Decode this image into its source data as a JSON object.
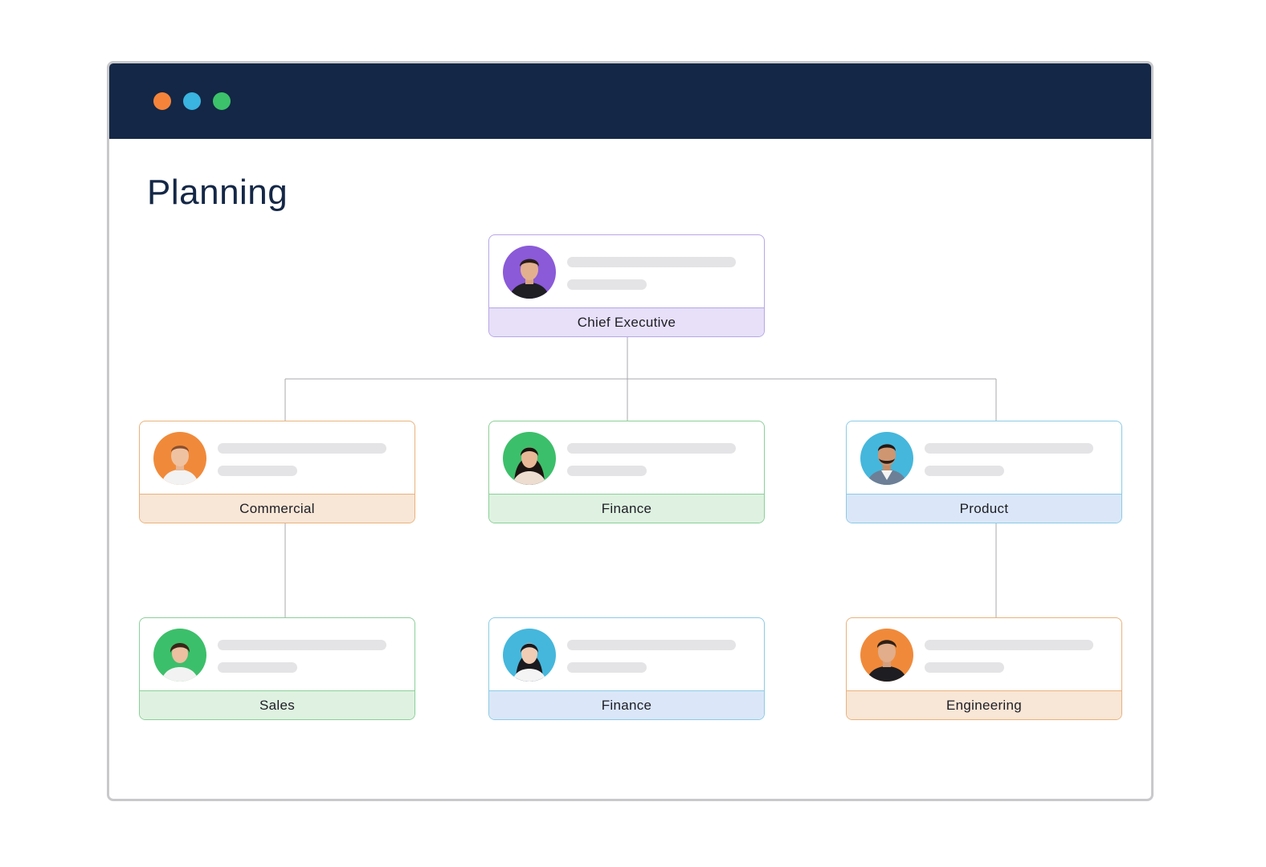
{
  "window": {
    "traffic_lights": [
      {
        "name": "close",
        "color": "#f5843a"
      },
      {
        "name": "minimize",
        "color": "#3ab4e0"
      },
      {
        "name": "maximize",
        "color": "#3cc26a"
      }
    ]
  },
  "page": {
    "title": "Planning"
  },
  "org_chart": {
    "root": {
      "label": "Chief Executive",
      "accent": "purple",
      "avatar_bg": "#8a5ad8"
    },
    "level1": [
      {
        "label": "Commercial",
        "accent": "orange",
        "avatar_bg": "#f08a3a"
      },
      {
        "label": "Finance",
        "accent": "green",
        "avatar_bg": "#3cbf6a"
      },
      {
        "label": "Product",
        "accent": "blue",
        "avatar_bg": "#45b7dc"
      }
    ],
    "level2": [
      {
        "label": "Sales",
        "accent": "green",
        "avatar_bg": "#3cbf6a"
      },
      {
        "label": "Finance",
        "accent": "blue",
        "avatar_bg": "#45b7dc"
      },
      {
        "label": "Engineering",
        "accent": "orange",
        "avatar_bg": "#f08a3a"
      }
    ]
  }
}
